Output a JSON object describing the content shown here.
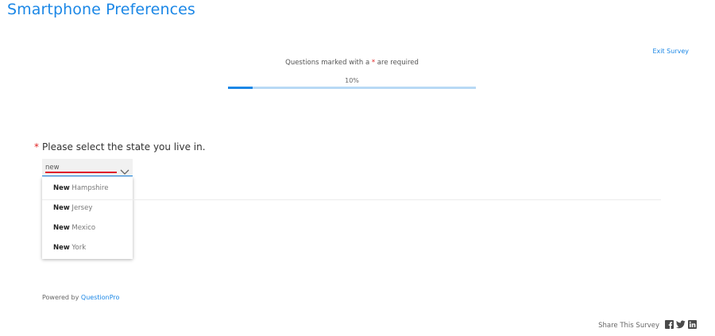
{
  "survey": {
    "title": "Smartphone Preferences",
    "exit_label": "Exit Survey",
    "required_note_prefix": "Questions marked with a ",
    "required_note_star": "*",
    "required_note_suffix": " are required",
    "progress_label": "10%",
    "progress_value": 0.1
  },
  "question": {
    "required_star": "*",
    "text": "Please select the state you live in.",
    "input_value": "new",
    "options": [
      {
        "match": "New",
        "rest": " Hampshire"
      },
      {
        "match": "New",
        "rest": " Jersey"
      },
      {
        "match": "New",
        "rest": " Mexico"
      },
      {
        "match": "New",
        "rest": " York"
      }
    ]
  },
  "footer": {
    "powered_prefix": "Powered by ",
    "powered_brand": "QuestionPro",
    "share_label": "Share This Survey",
    "social_icons": [
      "facebook-icon",
      "twitter-icon",
      "linkedin-icon"
    ]
  },
  "colors": {
    "accent": "#1b87e6",
    "required": "#e02424",
    "typing_underline": "#e01e2b"
  }
}
